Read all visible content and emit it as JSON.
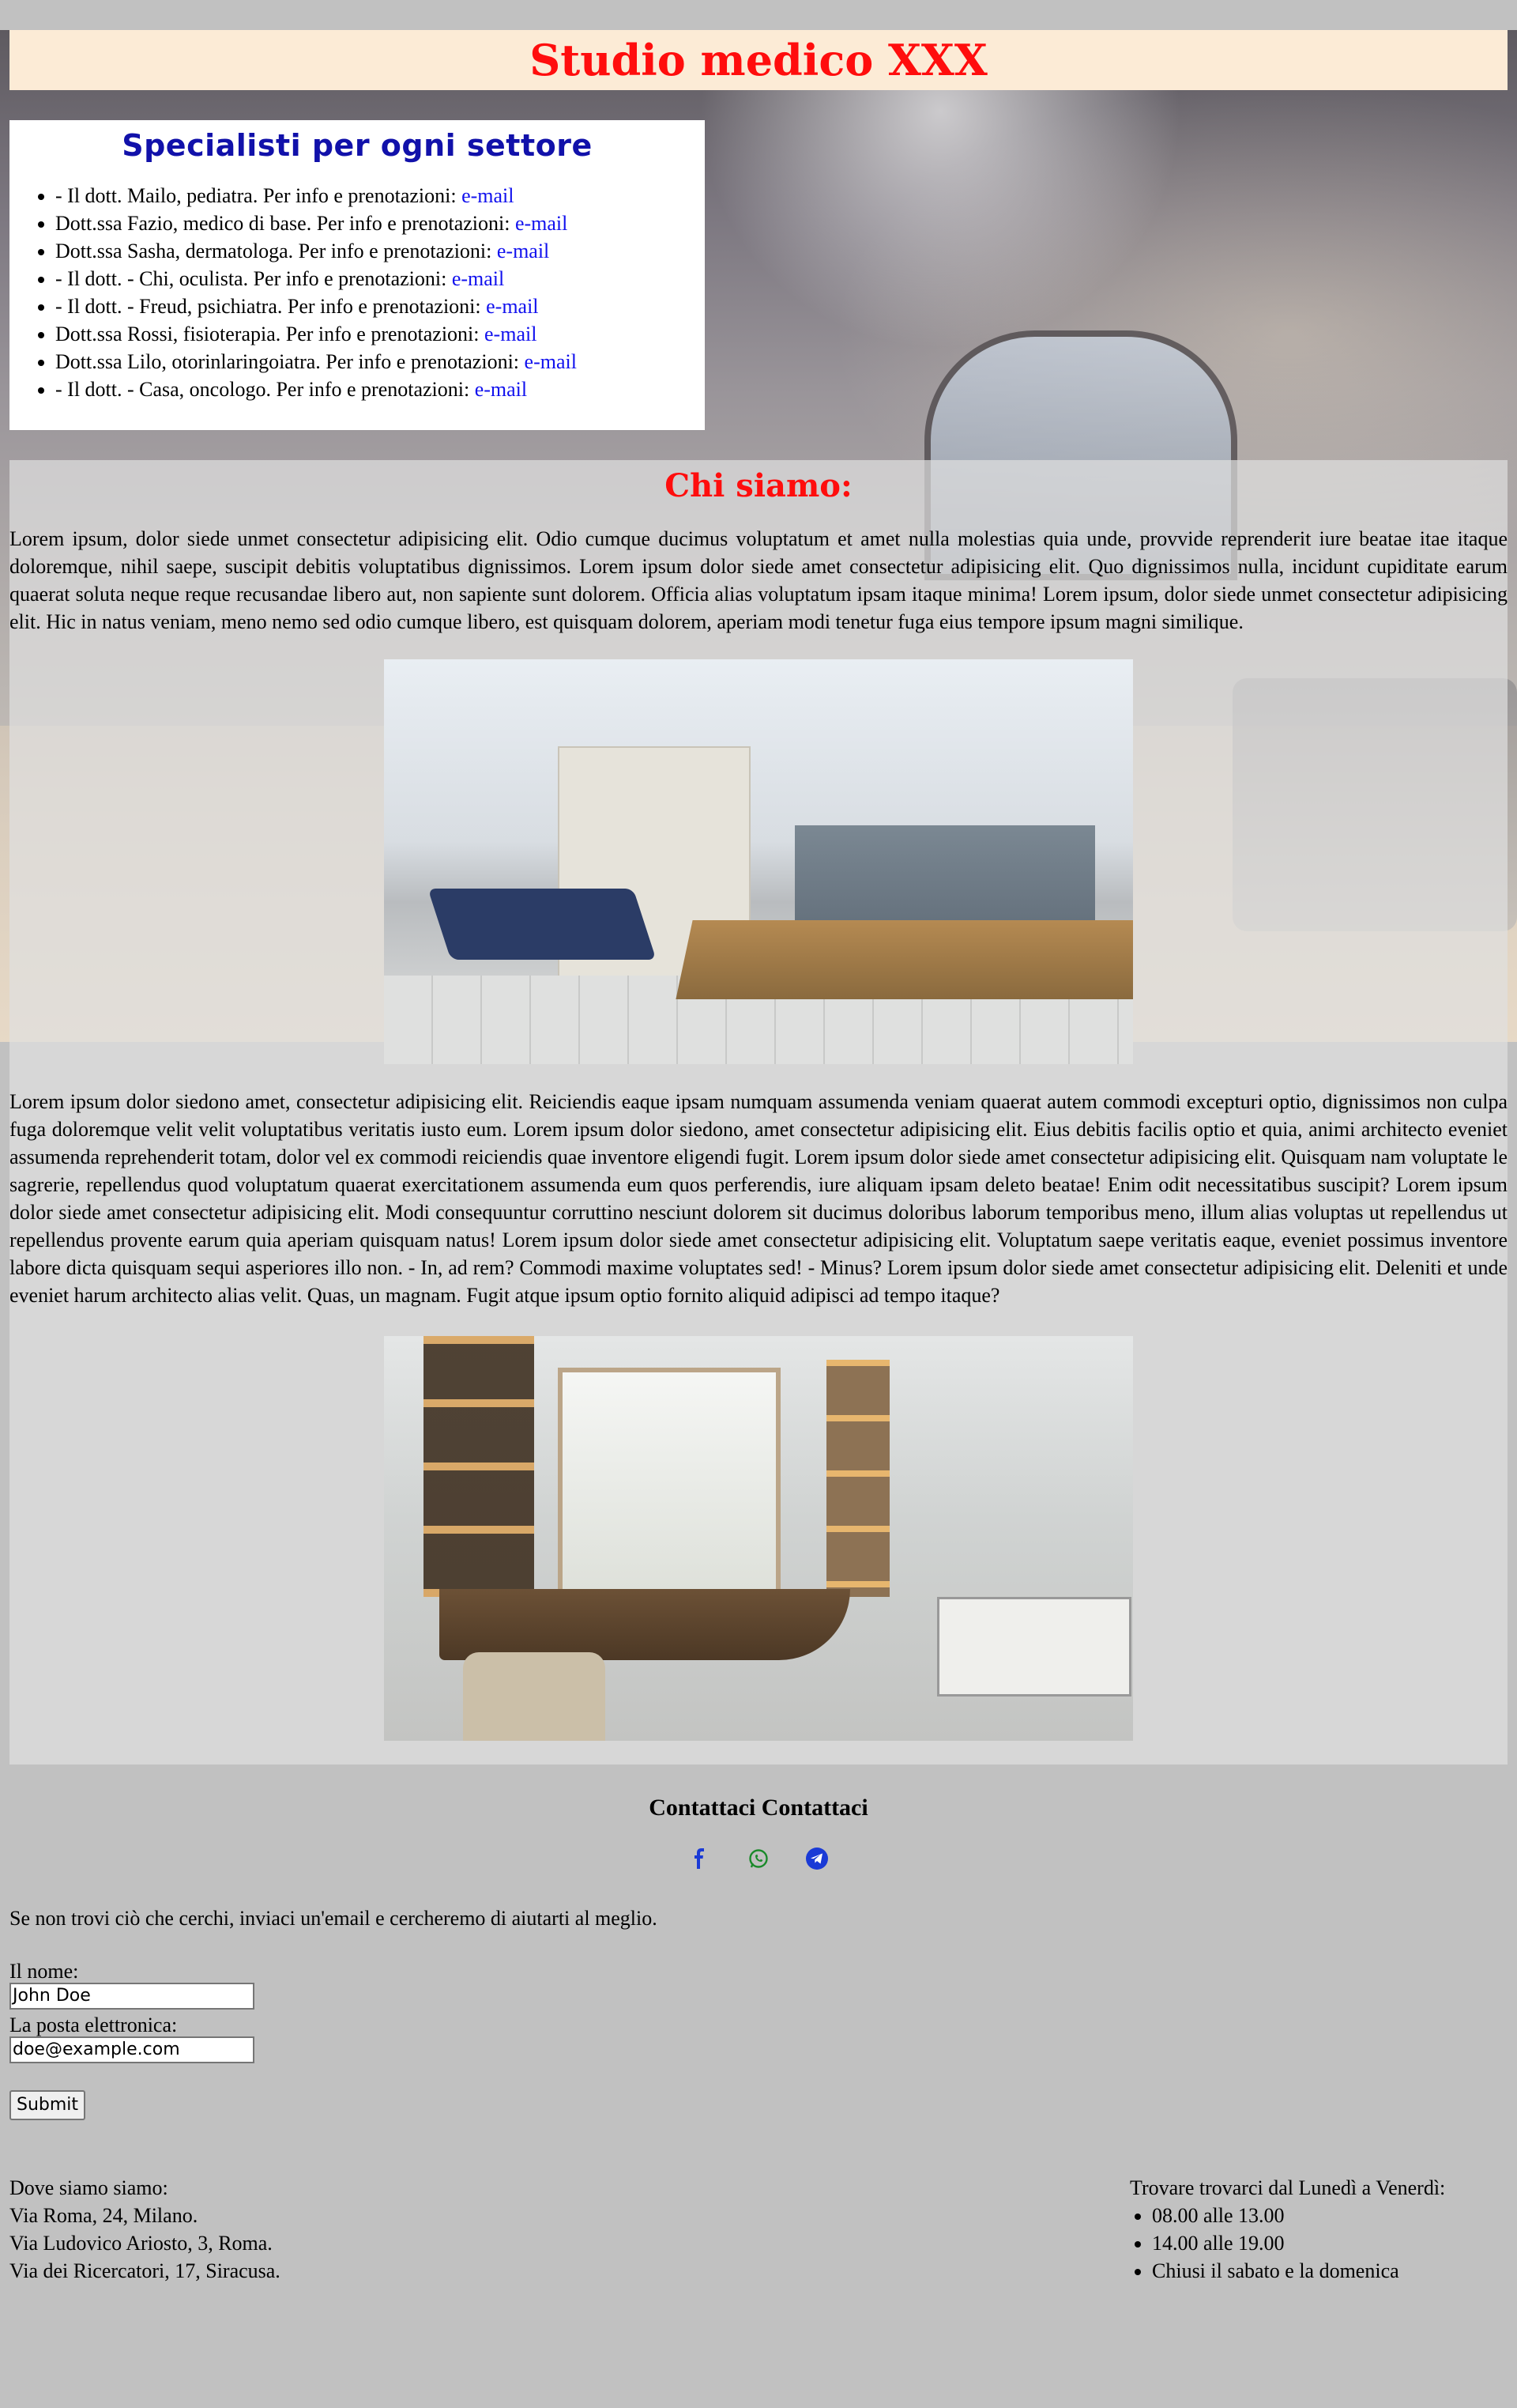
{
  "site_title": "Studio medico XXX",
  "specialists": {
    "heading": "Specialisti per ogni settore",
    "items": [
      {
        "text": "- Il dott. Mailo, pediatra. Per info e prenotazioni: ",
        "link": "e-mail"
      },
      {
        "text": "Dott.ssa Fazio, medico di base. Per info e prenotazioni: ",
        "link": "e-mail"
      },
      {
        "text": "Dott.ssa Sasha, dermatologa. Per info e prenotazioni: ",
        "link": "e-mail"
      },
      {
        "text": "- Il dott. - Chi, oculista. Per info e prenotazioni: ",
        "link": "e-mail"
      },
      {
        "text": "- Il dott. - Freud, psichiatra. Per info e prenotazioni: ",
        "link": "e-mail"
      },
      {
        "text": "Dott.ssa Rossi, fisioterapia. Per info e prenotazioni: ",
        "link": "e-mail"
      },
      {
        "text": "Dott.ssa Lilo, otorinlaringoiatra. Per info e prenotazioni: ",
        "link": "e-mail"
      },
      {
        "text": "- Il dott. - Casa, oncologo. Per info e prenotazioni: ",
        "link": "e-mail"
      }
    ]
  },
  "about": {
    "heading": "Chi siamo:",
    "paragraph1": "Lorem ipsum, dolor siede unmet consectetur adipisicing elit. Odio cumque ducimus voluptatum et amet nulla molestias quia unde, provvide reprenderit iure beatae itae itaque doloremque, nihil saepe, suscipit debitis voluptatibus dignissimos. Lorem ipsum dolor siede amet consectetur adipisicing elit. Quo dignissimos nulla, incidunt cupiditate earum quaerat soluta neque reque recusandae libero aut, non sapiente sunt dolorem. Officia alias voluptatum ipsam itaque minima! Lorem ipsum, dolor siede unmet consectetur adipisicing elit. Hic in natus veniam, meno nemo sed odio cumque libero, est quisquam dolorem, aperiam modi tenetur fuga eius tempore ipsum magni similique.",
    "paragraph2": "Lorem ipsum dolor siedono amet, consectetur adipisicing elit. Reiciendis eaque ipsam numquam assumenda veniam quaerat autem commodi excepturi optio, dignissimos non culpa fuga doloremque velit velit voluptatibus veritatis iusto eum. Lorem ipsum dolor siedono, amet consectetur adipisicing elit. Eius debitis facilis optio et quia, animi architecto eveniet assumenda reprehenderit totam, dolor vel ex commodi reiciendis quae inventore eligendi fugit. Lorem ipsum dolor siede amet consectetur adipisicing elit. Quisquam nam voluptate le sagrerie, repellendus quod voluptatum quaerat exercitationem assumenda eum quos perferendis, iure aliquam ipsam deleto beatae! Enim odit necessitatibus suscipit? Lorem ipsum dolor siede amet consectetur adipisicing elit. Modi consequuntur corruttino nesciunt dolorem sit ducimus doloribus laborum temporibus meno, illum alias voluptas ut repellendus ut repellendus provente earum quia aperiam quisquam natus! Lorem ipsum dolor siede amet consectetur adipisicing elit. Voluptatum saepe veritatis eaque, eveniet possimus inventore labore dicta quisquam sequi asperiores illo non. - In, ad rem? Commodi maxime voluptates sed! - Minus? Lorem ipsum dolor siede amet consectetur adipisicing elit. Deleniti et unde eveniet harum architecto alias velit. Quas, un magnam. Fugit atque ipsum optio fornito aliquid adipisci ad tempo itaque?"
  },
  "contact": {
    "heading": "Contattaci Contattaci",
    "social_icons": [
      {
        "name": "facebook-icon",
        "color": "#1a3ad6"
      },
      {
        "name": "whatsapp-icon",
        "color": "#1a8a2a"
      },
      {
        "name": "telegram-icon",
        "color": "#1a3ad6"
      }
    ],
    "intro": "Se non trovi ciò che cerchi, inviaci un'email e cercheremo di aiutarti al meglio.",
    "name_label": "Il nome:",
    "name_value": "John Doe",
    "email_label": "La posta elettronica:",
    "email_value": "doe@example.com",
    "submit_label": "Submit"
  },
  "footer": {
    "location_heading": "Dove siamo siamo:",
    "locations": [
      "Via Roma, 24, Milano.",
      "Via Ludovico Ariosto, 3, Roma.",
      "Via dei Ricercatori, 17, Siracusa."
    ],
    "hours_heading": "Trovare trovarci dal Lunedì a Venerdì:",
    "hours": [
      "08.00 alle 13.00",
      "14.00 alle 19.00",
      "Chiusi il sabato e la domenica"
    ]
  },
  "colors": {
    "title_red": "#ff0d0d",
    "heading_blue": "#1111aa",
    "link_blue": "#1111ee",
    "title_band": "#fcebd6",
    "page_bg": "#c1c1c1"
  }
}
